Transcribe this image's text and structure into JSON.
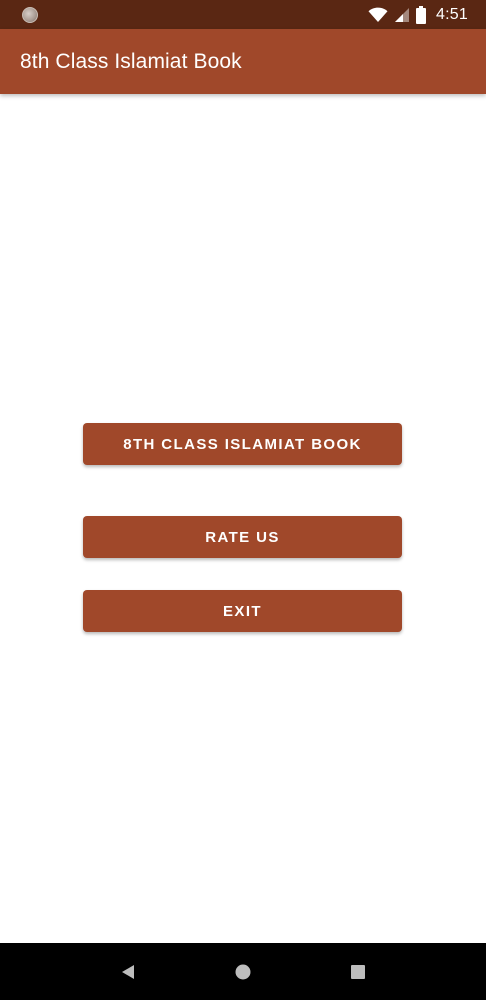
{
  "status_bar": {
    "time": "4:51",
    "icons": [
      "notification-dot-icon",
      "wifi-icon",
      "signal-icon",
      "battery-icon"
    ]
  },
  "app_bar": {
    "title": "8th Class Islamiat Book"
  },
  "buttons": {
    "book_label": "8th Class Islamiat Book",
    "rate_label": "Rate Us",
    "exit_label": "Exit"
  },
  "nav_bar": {
    "icons": [
      "back-icon",
      "home-icon",
      "recents-icon"
    ]
  },
  "colors": {
    "status_bar": "#5a2713",
    "primary": "#a0482a",
    "background": "#ffffff",
    "nav_bar": "#000000",
    "on_primary": "#ffffff"
  }
}
